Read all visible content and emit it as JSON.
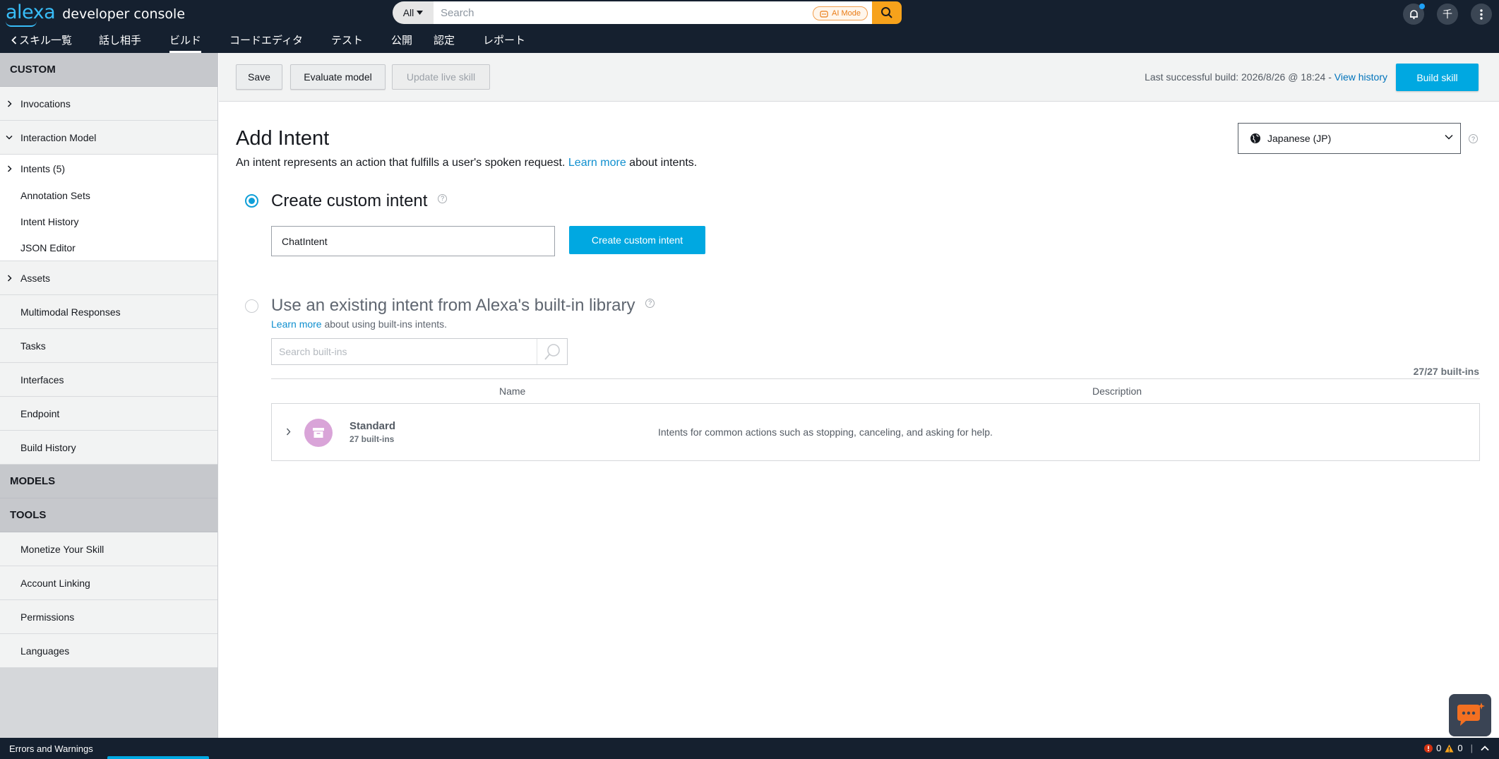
{
  "header": {
    "logo_brand": "alexa",
    "logo_product": "developer console",
    "search_scope": "All",
    "search_placeholder": "Search",
    "ai_mode_label": "AI Mode",
    "user_initial": "千",
    "nav": [
      {
        "label": "スキル一覧"
      },
      {
        "label": "話し相手"
      },
      {
        "label": "ビルド"
      },
      {
        "label": "コードエディタ"
      },
      {
        "label": "テスト"
      },
      {
        "label": "公開"
      },
      {
        "label": "認定"
      },
      {
        "label": "レポート"
      }
    ]
  },
  "sidebar": {
    "sections": {
      "custom": "CUSTOM",
      "models": "MODELS",
      "tools": "TOOLS"
    },
    "items": {
      "invocations": "Invocations",
      "interaction_model": "Interaction Model",
      "intents": "Intents (5)",
      "annotation_sets": "Annotation Sets",
      "intent_history": "Intent History",
      "json_editor": "JSON Editor",
      "assets": "Assets",
      "multimodal_responses": "Multimodal Responses",
      "tasks": "Tasks",
      "interfaces": "Interfaces",
      "endpoint": "Endpoint",
      "build_history": "Build History",
      "monetize": "Monetize Your Skill",
      "account_linking": "Account Linking",
      "permissions": "Permissions",
      "languages": "Languages"
    }
  },
  "toolbar": {
    "save": "Save",
    "evaluate": "Evaluate model",
    "update_live": "Update live skill",
    "build_info_prefix": "Last successful build: 2026/8/26 @ 18:24 -",
    "view_history": "View history",
    "build_skill": "Build skill"
  },
  "main": {
    "title": "Add Intent",
    "desc_before": "An intent represents an action that fulfills a user's spoken request.",
    "desc_link": "Learn more",
    "desc_after": "about intents.",
    "language": "Japanese (JP)",
    "custom_option_title": "Create custom intent",
    "intent_name_value": "ChatIntent",
    "create_button": "Create custom intent",
    "builtin_option_title": "Use an existing intent from Alexa's built-in library",
    "builtin_learn_link": "Learn more",
    "builtin_learn_after": "about using built-ins intents.",
    "builtin_search_placeholder": "Search built-ins",
    "builtin_count": "27/27 built-ins",
    "table": {
      "columns": [
        "Name",
        "Description"
      ],
      "rows": [
        {
          "name": "Standard",
          "sub": "27 built-ins",
          "description": "Intents for common actions such as stopping, canceling, and asking for help."
        }
      ]
    }
  },
  "footer": {
    "label": "Errors and Warnings",
    "errors": "0",
    "warnings": "0"
  },
  "colors": {
    "header_bg": "#15202f",
    "accent": "#00a8e1",
    "link": "#0073bb",
    "search_button": "#f7a21b"
  }
}
